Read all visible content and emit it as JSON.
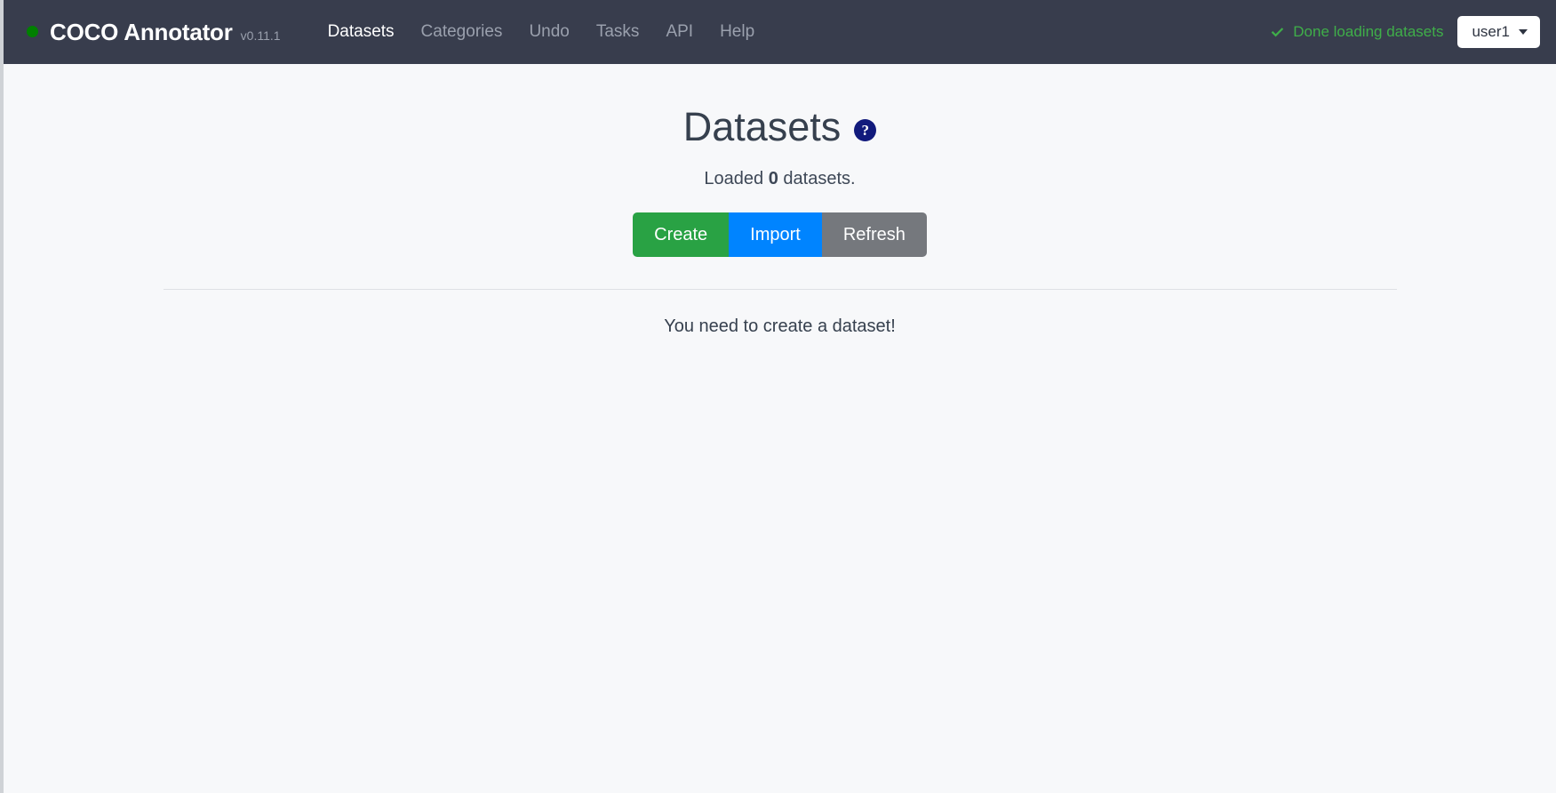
{
  "navbar": {
    "status_dot": "online-dot",
    "brand": "COCO Annotator",
    "version": "v0.11.1",
    "nav_items": [
      {
        "label": "Datasets",
        "active": true
      },
      {
        "label": "Categories",
        "active": false
      },
      {
        "label": "Undo",
        "active": false
      },
      {
        "label": "Tasks",
        "active": false
      },
      {
        "label": "API",
        "active": false
      },
      {
        "label": "Help",
        "active": false
      }
    ],
    "load_status": {
      "icon": "check-icon",
      "text": "Done loading datasets",
      "color": "#3fae49"
    },
    "user": {
      "label": "user1",
      "caret": "chevron-down-icon"
    },
    "background_color": "#383d4d"
  },
  "main": {
    "title": "Datasets",
    "help_icon": "question-mark-icon",
    "subtitle_prefix": "Loaded ",
    "subtitle_count": "0",
    "subtitle_suffix": " datasets.",
    "buttons": {
      "create": {
        "label": "Create",
        "color": "#29a244"
      },
      "import": {
        "label": "Import",
        "color": "#0084ff"
      },
      "refresh": {
        "label": "Refresh",
        "color": "#75787d"
      }
    },
    "empty_message": "You need to create a dataset!"
  }
}
